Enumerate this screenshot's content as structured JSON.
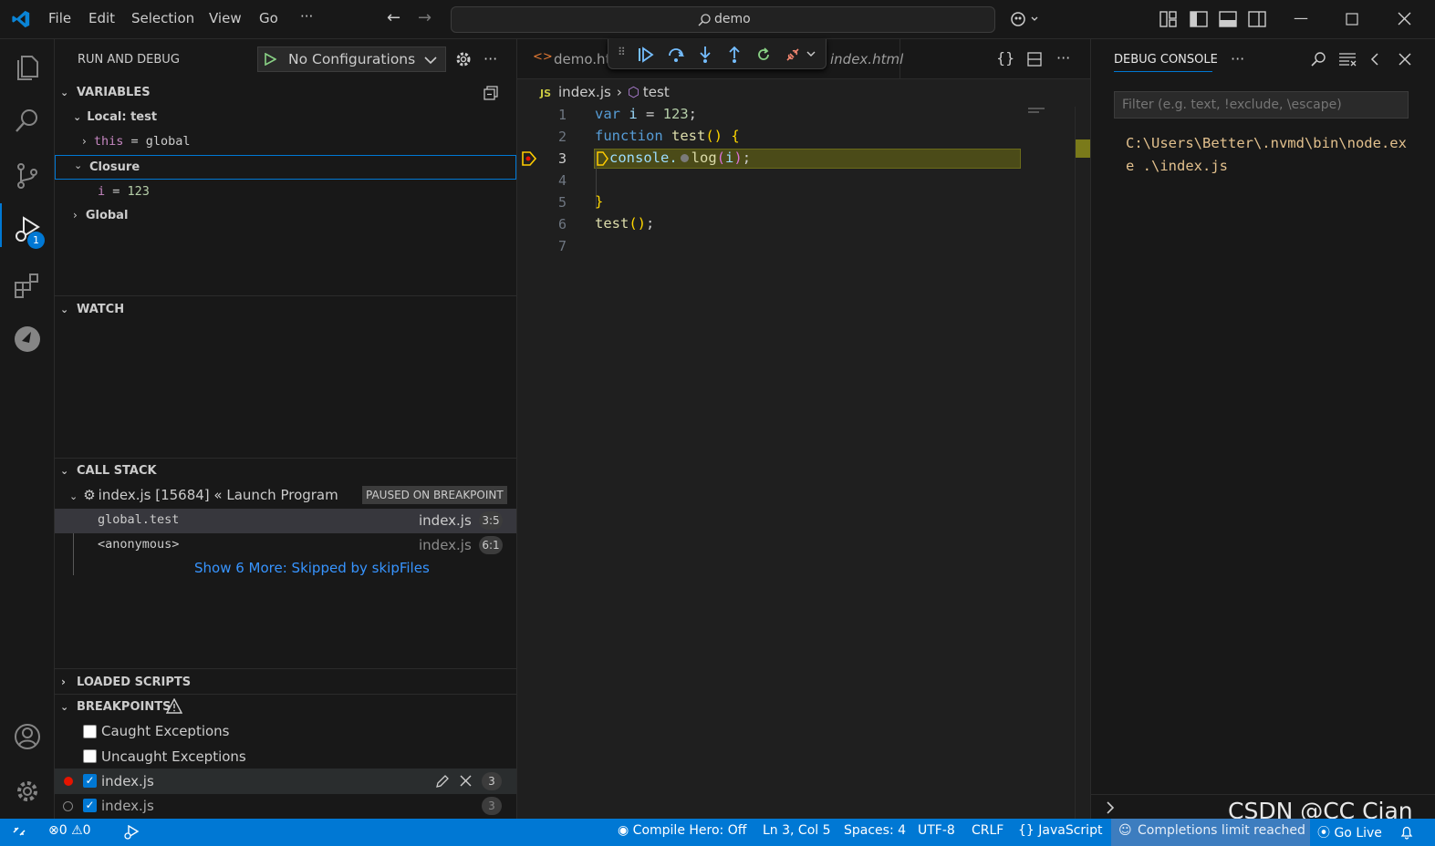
{
  "titlebar": {
    "menu": [
      "File",
      "Edit",
      "Selection",
      "View",
      "Go",
      "···"
    ],
    "search": "demo"
  },
  "sidebar": {
    "title": "RUN AND DEBUG",
    "config": "No Configurations",
    "variables": {
      "header": "VARIABLES",
      "local": "Local: test",
      "this_name": "this",
      "this_eq": " = ",
      "this_val": "global",
      "closure": "Closure",
      "i_name": "i",
      "i_eq": " = ",
      "i_val": "123",
      "global": "Global"
    },
    "watch": "WATCH",
    "callstack": {
      "header": "CALL STACK",
      "thread": "index.js [15684] « Launch Program",
      "paused": "PAUSED ON BREAKPOINT",
      "frames": [
        {
          "name": "global.test",
          "file": "index.js",
          "pos": "3:5"
        },
        {
          "name": "<anonymous>",
          "file": "index.js",
          "pos": "6:1"
        }
      ],
      "more": "Show 6 More: Skipped by skipFiles"
    },
    "loaded": "LOADED SCRIPTS",
    "breakpoints": {
      "header": "BREAKPOINTS",
      "items": [
        {
          "label": "Caught Exceptions"
        },
        {
          "label": "Uncaught Exceptions"
        },
        {
          "label": "index.js",
          "count": "3"
        },
        {
          "label": "index.js",
          "count": "3"
        }
      ]
    }
  },
  "editor": {
    "tabs": [
      "demo.ht",
      "index.html"
    ],
    "breadcrumb": [
      "index.js",
      "test"
    ],
    "lines": [
      "1",
      "2",
      "3",
      "4",
      "5",
      "6",
      "7"
    ],
    "code": {
      "l1_kw": "var",
      "l1_var": " i",
      "l1_eq": " = ",
      "l1_num": "123",
      "l1_end": ";",
      "l2_kw": "function",
      "l2_fn": " test",
      "l2_br": "() {",
      "l3_obj": "console.",
      "l3_fn": "log",
      "l3_o": "(",
      "l3_var": "i",
      "l3_c": ")",
      "l3_end": ";",
      "l5_br": "}",
      "l6_fn": "test",
      "l6_br": "()",
      "l6_end": ";"
    }
  },
  "panel": {
    "title": "DEBUG CONSOLE",
    "filter_placeholder": "Filter (e.g. text, !exclude, \\escape)",
    "output1": "C:\\Users\\Better\\.nvmd\\bin\\node.ex",
    "output2": "e .\\index.js"
  },
  "status": {
    "errors": "0",
    "warnings": "0",
    "compile": "Compile Hero: Off",
    "position": "Ln 3, Col 5",
    "spaces": "Spaces: 4",
    "encoding": "UTF-8",
    "eol": "CRLF",
    "language": "JavaScript",
    "completions": "Completions limit reached",
    "golive": "Go Live"
  },
  "watermark": "CSDN @CC Cian",
  "badge": "1"
}
